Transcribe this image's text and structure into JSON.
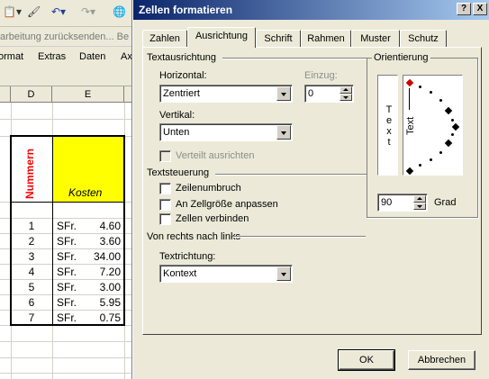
{
  "excel": {
    "taskbar_text": "arbeitung zurücksenden... Be",
    "menu": [
      "ormat",
      "Extras",
      "Daten",
      "Ax"
    ],
    "column_headers": [
      "D",
      "E"
    ],
    "header_vertical": "Nummern",
    "header_cost": "Kosten",
    "rows": [
      {
        "num": "1",
        "cur": "SFr.",
        "val": "4.60"
      },
      {
        "num": "2",
        "cur": "SFr.",
        "val": "3.60"
      },
      {
        "num": "3",
        "cur": "SFr.",
        "val": "34.00"
      },
      {
        "num": "4",
        "cur": "SFr.",
        "val": "7.20"
      },
      {
        "num": "5",
        "cur": "SFr.",
        "val": "3.00"
      },
      {
        "num": "6",
        "cur": "SFr.",
        "val": "5.95"
      },
      {
        "num": "7",
        "cur": "SFr.",
        "val": "0.75"
      }
    ],
    "colors": {
      "header_yellow": "#ffff00",
      "header_red": "#ff0000"
    }
  },
  "dialog": {
    "title": "Zellen formatieren",
    "help_button": "?",
    "close_button": "X",
    "tabs": [
      "Zahlen",
      "Ausrichtung",
      "Schrift",
      "Rahmen",
      "Muster",
      "Schutz"
    ],
    "active_tab": "Ausrichtung",
    "textausrichtung": {
      "group": "Textausrichtung",
      "horizontal_label": "Horizontal:",
      "horizontal_value": "Zentriert",
      "einzug_label": "Einzug:",
      "einzug_value": "0",
      "vertikal_label": "Vertikal:",
      "vertikal_value": "Unten",
      "verteilt_label": "Verteilt ausrichten"
    },
    "textsteuerung": {
      "group": "Textsteuerung",
      "zeilenumbruch": "Zeilenumbruch",
      "anpassen": "An Zellgröße anpassen",
      "verbinden": "Zellen verbinden"
    },
    "rtl": {
      "group": "Von rechts nach links",
      "richtung_label": "Textrichtung:",
      "richtung_value": "Kontext"
    },
    "orientierung": {
      "group": "Orientierung",
      "vertical_text": "Text",
      "rotated_text": "Text",
      "grad_value": "90",
      "grad_label": "Grad"
    },
    "ok": "OK",
    "cancel": "Abbrechen"
  }
}
